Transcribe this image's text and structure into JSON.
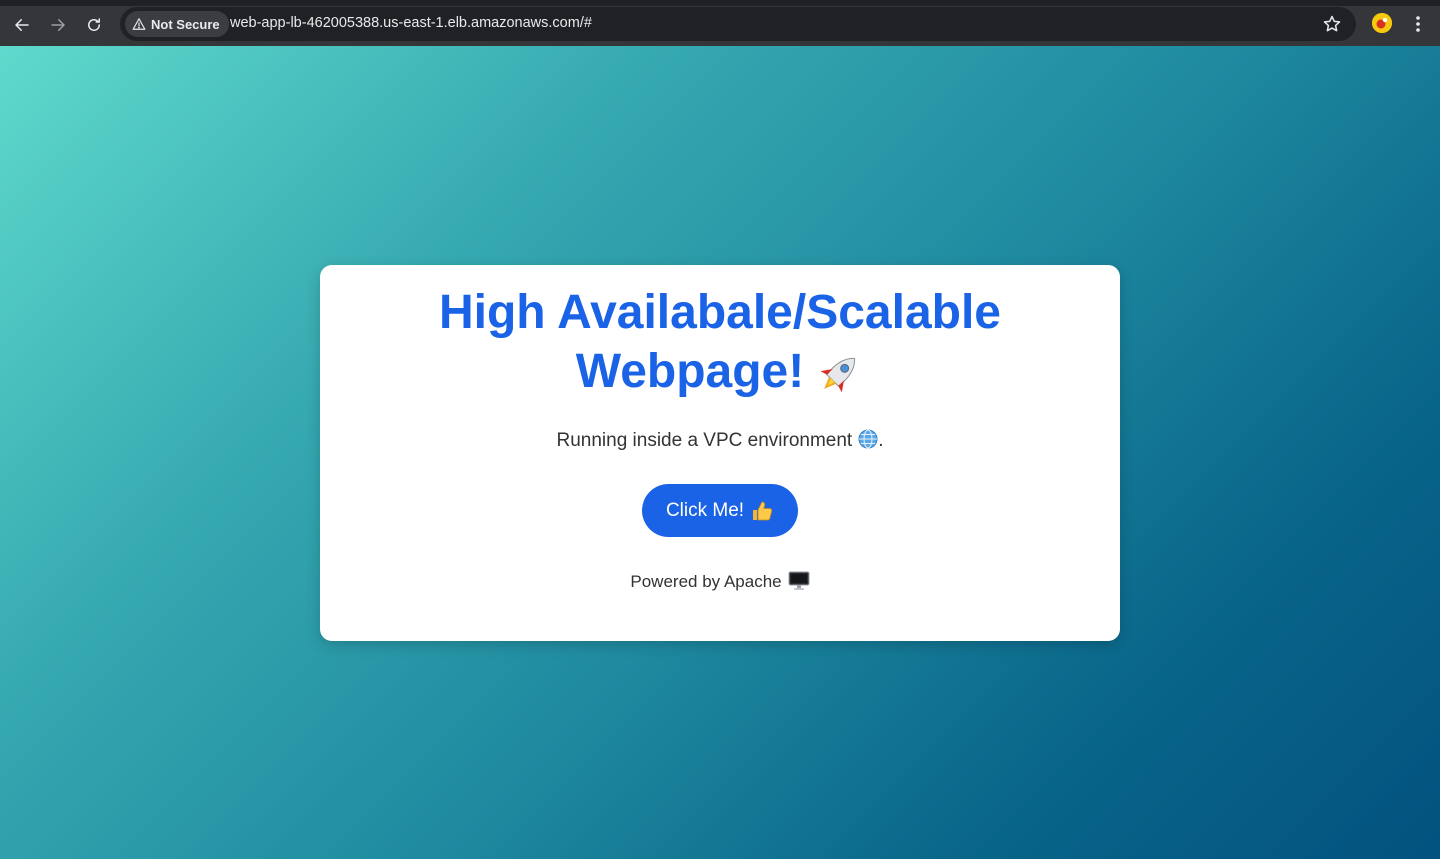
{
  "browser": {
    "security_label": "Not Secure",
    "url": "web-app-lb-462005388.us-east-1.elb.amazonaws.com/#"
  },
  "page": {
    "heading_line1": "High Availabale/Scalable",
    "heading_line2": "Webpage!",
    "subtitle_text": "Running inside a VPC environment",
    "subtitle_suffix": ".",
    "button_label": "Click Me!",
    "footer_text": "Powered by Apache"
  },
  "icons": {
    "heading_icon": "rocket-icon",
    "subtitle_icon": "globe-icon",
    "button_icon": "thumbs-up-icon",
    "footer_icon": "desktop-computer-icon"
  },
  "colors": {
    "accent": "#1a62e6",
    "card_background": "#ffffff",
    "gradient_start": "#5fd9cc",
    "gradient_end": "#03527f",
    "text": "#333333"
  }
}
